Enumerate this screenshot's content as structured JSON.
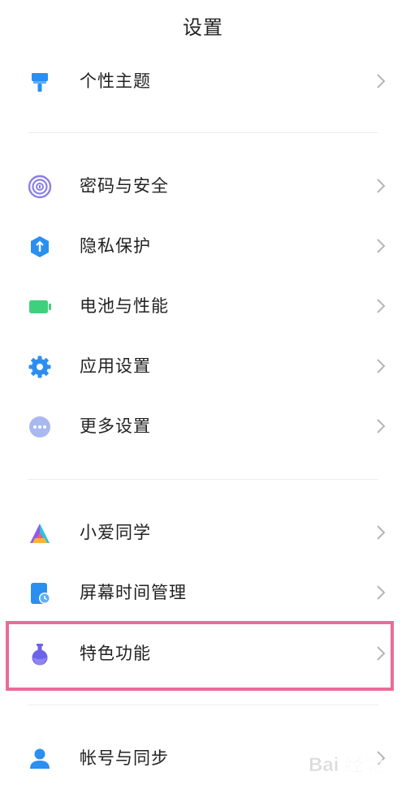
{
  "header": {
    "title": "设置"
  },
  "items": [
    {
      "label": "个性主题",
      "icon": "paint-brush-icon"
    },
    {
      "label": "密码与安全",
      "icon": "fingerprint-icon"
    },
    {
      "label": "隐私保护",
      "icon": "privacy-shield-icon"
    },
    {
      "label": "电池与性能",
      "icon": "battery-icon"
    },
    {
      "label": "应用设置",
      "icon": "gear-icon"
    },
    {
      "label": "更多设置",
      "icon": "more-dots-icon"
    },
    {
      "label": "小爱同学",
      "icon": "xiaoai-icon"
    },
    {
      "label": "屏幕时间管理",
      "icon": "screen-time-icon"
    },
    {
      "label": "特色功能",
      "icon": "flask-icon"
    },
    {
      "label": "帐号与同步",
      "icon": "account-icon"
    }
  ],
  "watermark": {
    "text": "Bai 经验"
  },
  "colors": {
    "highlight": "#ec6b98",
    "blue": "#2b8ff0",
    "green": "#3fd07d",
    "purple": "#6c63e8"
  }
}
